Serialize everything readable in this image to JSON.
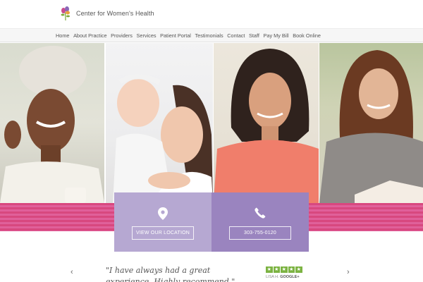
{
  "header": {
    "brand": "Center for Women's Health"
  },
  "nav": {
    "items": [
      "Home",
      "About Practice",
      "Providers",
      "Services",
      "Patient Portal",
      "Testimonials",
      "Contact",
      "Staff",
      "Pay My Bill",
      "Book Online"
    ]
  },
  "cta": {
    "location_label": "VIEW OUR LOCATION",
    "phone_label": "303-755-0120"
  },
  "testimonial": {
    "quote": "\"I have always had a great experience. Highly recommend.\"",
    "rating_stars": 5,
    "reviewer": "LISA H.",
    "source": "GOOGLE+"
  },
  "colors": {
    "band_pink": "#d8487f",
    "location_box": "#b6a8d2",
    "phone_box": "#9a84bf",
    "star_green": "#7cb342"
  }
}
